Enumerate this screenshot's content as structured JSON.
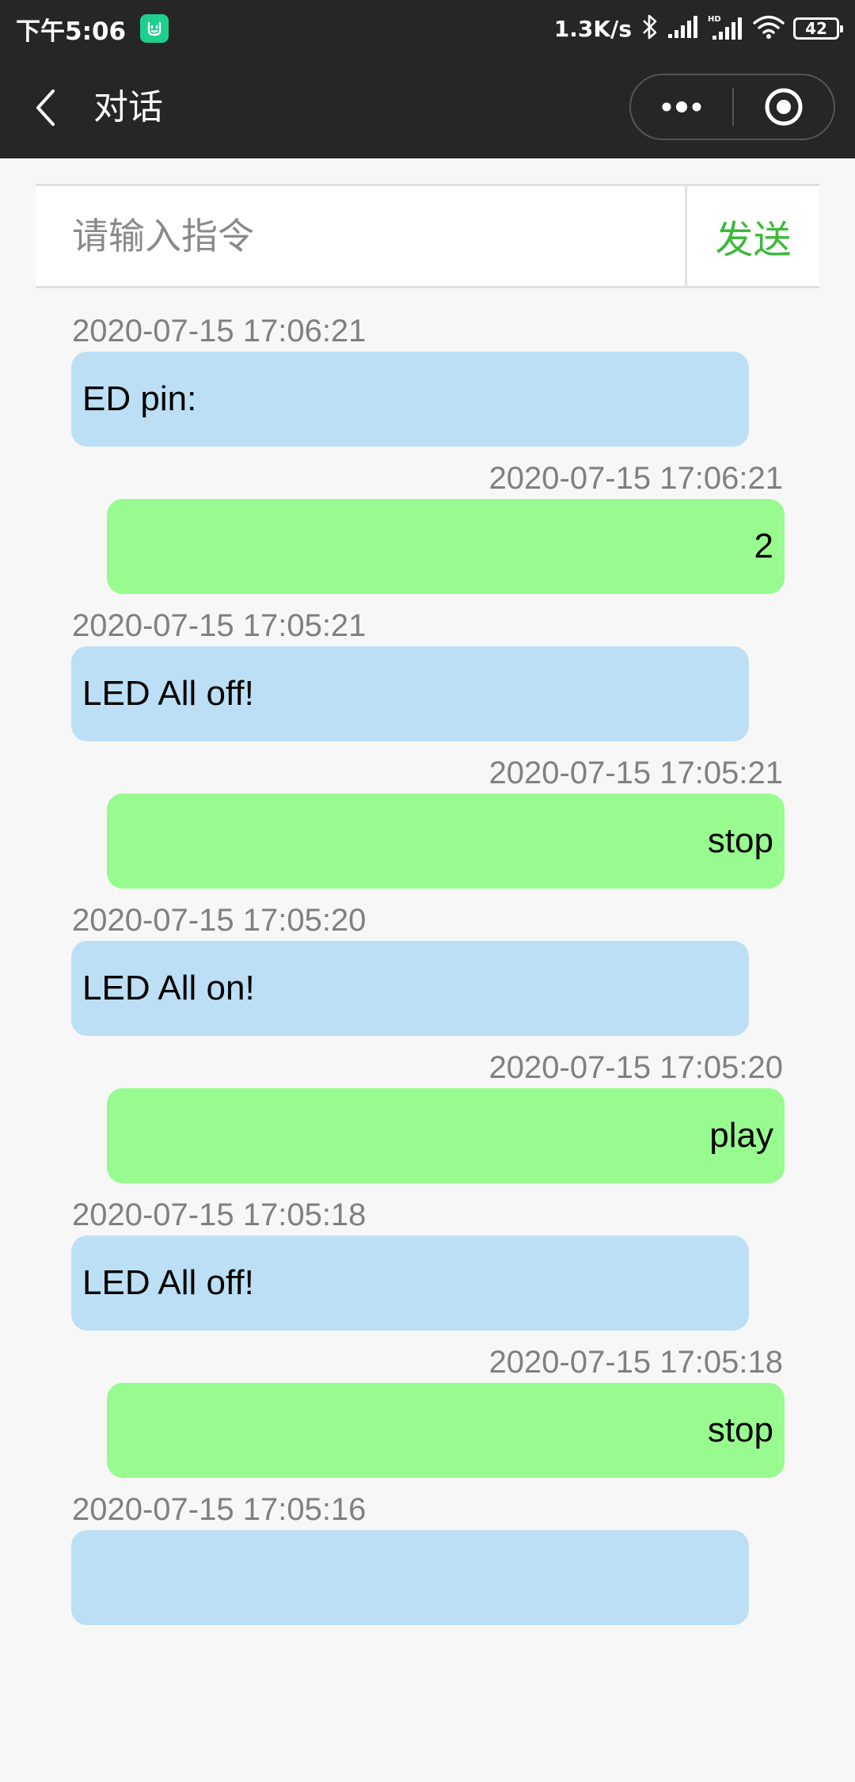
{
  "status_bar": {
    "time": "下午5:06",
    "net_speed": "1.3K/s",
    "battery": "42",
    "icons": [
      "mi-home-icon",
      "bluetooth-icon",
      "signal-icon",
      "hd-signal-icon",
      "wifi-icon",
      "battery-icon"
    ]
  },
  "nav": {
    "title": "对话",
    "icons": [
      "back-arrow-icon",
      "more-dots-icon",
      "close-target-icon"
    ]
  },
  "input": {
    "placeholder": "请输入指令",
    "value": "",
    "send_label": "发送",
    "send_color": "#3db93b"
  },
  "colors": {
    "received_bubble": "#bcdff5",
    "sent_bubble": "#98fb8f",
    "timestamp": "#808080",
    "nav_background": "#262626"
  },
  "messages": [
    {
      "type": "received",
      "time": "2020-07-15 17:06:21",
      "text": "ED pin:"
    },
    {
      "type": "sent",
      "time": "2020-07-15 17:06:21",
      "text": "2"
    },
    {
      "type": "received",
      "time": "2020-07-15 17:05:21",
      "text": "LED All off!"
    },
    {
      "type": "sent",
      "time": "2020-07-15 17:05:21",
      "text": "stop"
    },
    {
      "type": "received",
      "time": "2020-07-15 17:05:20",
      "text": "LED All on!"
    },
    {
      "type": "sent",
      "time": "2020-07-15 17:05:20",
      "text": "play"
    },
    {
      "type": "received",
      "time": "2020-07-15 17:05:18",
      "text": "LED All off!"
    },
    {
      "type": "sent",
      "time": "2020-07-15 17:05:18",
      "text": "stop"
    },
    {
      "type": "received",
      "time": "2020-07-15 17:05:16",
      "text": ""
    }
  ]
}
